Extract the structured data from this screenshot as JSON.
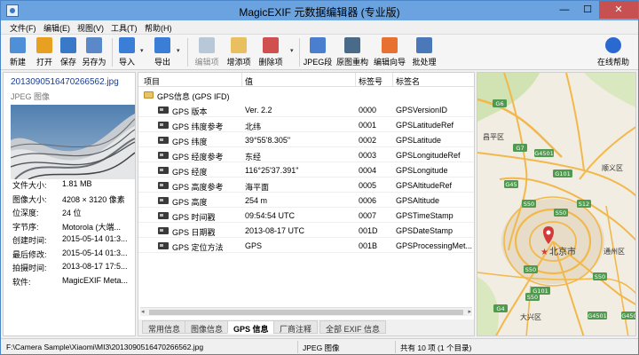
{
  "window": {
    "title": "MagicEXIF 元数据编辑器 (专业版)",
    "minimize": "—",
    "maximize": "☐",
    "close": "✕"
  },
  "menu": [
    {
      "label": "文件(F)"
    },
    {
      "label": "编辑(E)"
    },
    {
      "label": "视图(V)"
    },
    {
      "label": "工具(T)"
    },
    {
      "label": "帮助(H)"
    }
  ],
  "toolbar": {
    "new": "新建",
    "open": "打开",
    "save": "保存",
    "save_as": "另存为",
    "import": "导入",
    "export": "导出",
    "edit_item": "编辑项",
    "add_item": "增添项",
    "delete_item": "删除项",
    "jpeg_segment": "JPEG段",
    "rebuild": "原图重构",
    "wizard": "编辑向导",
    "batch": "批处理",
    "help": "在线帮助",
    "colors": {
      "new": "#4f8fd8",
      "open": "#e8a020",
      "save": "#3a78c8",
      "save_as": "#5a88c8",
      "import": "#3a7ed8",
      "export": "#3a7ed8",
      "edit_item": "#b8c8d8",
      "add_item": "#e8c060",
      "delete_item": "#d05050",
      "jpeg_segment": "#4a7fd0",
      "rebuild": "#4a6a8a",
      "wizard": "#e87030",
      "batch": "#4a78b8",
      "help": "#2a6ad0"
    }
  },
  "file": {
    "name": "20130905164702665​62.jpg",
    "type": "JPEG 图像",
    "properties": [
      {
        "label": "文件大小:",
        "value": "1.81 MB"
      },
      {
        "label": "图像大小:",
        "value": "4208 × 3120 像素"
      },
      {
        "label": "位深度:",
        "value": "24 位"
      },
      {
        "label": "字节序:",
        "value": "Motorola (大端..."
      },
      {
        "label": "创建时间:",
        "value": "2015-05-14 01:3..."
      },
      {
        "label": "最后修改:",
        "value": "2015-05-14 01:3..."
      },
      {
        "label": "拍摄时间:",
        "value": "2013-08-17 17:5..."
      },
      {
        "label": "软件:",
        "value": "MagicEXIF Meta..."
      }
    ]
  },
  "table": {
    "headers": {
      "item": "项目",
      "value": "值",
      "tag": "标签号",
      "tag_name": "标签名"
    },
    "group": "GPS信息 (GPS IFD)",
    "rows": [
      {
        "name": "GPS 版本",
        "value": "Ver. 2.2",
        "tag": "0000",
        "tag_name": "GPSVersionID"
      },
      {
        "name": "GPS 纬度参考",
        "value": "北纬",
        "tag": "0001",
        "tag_name": "GPSLatitudeRef"
      },
      {
        "name": "GPS 纬度",
        "value": "39°55'8.305\"",
        "tag": "0002",
        "tag_name": "GPSLatitude"
      },
      {
        "name": "GPS 经度参考",
        "value": "东经",
        "tag": "0003",
        "tag_name": "GPSLongitudeRef"
      },
      {
        "name": "GPS 经度",
        "value": "116°25'37.391\"",
        "tag": "0004",
        "tag_name": "GPSLongitude"
      },
      {
        "name": "GPS 高度参考",
        "value": "海平面",
        "tag": "0005",
        "tag_name": "GPSAltitudeRef"
      },
      {
        "name": "GPS 高度",
        "value": "254 m",
        "tag": "0006",
        "tag_name": "GPSAltitude"
      },
      {
        "name": "GPS 时间戳",
        "value": "09:54:54 UTC",
        "tag": "0007",
        "tag_name": "GPSTimeStamp"
      },
      {
        "name": "GPS 日期戳",
        "value": "2013-08-17 UTC",
        "tag": "001D",
        "tag_name": "GPSDateStamp"
      },
      {
        "name": "GPS 定位方法",
        "value": "GPS",
        "tag": "001B",
        "tag_name": "GPSProcessingMet..."
      }
    ],
    "tabs": [
      "常用信息",
      "图像信息",
      "GPS 信息",
      "厂商注释",
      "全部 EXIF 信息"
    ],
    "active_tab": "GPS 信息"
  },
  "map": {
    "labels": {
      "changping": "昌平区",
      "shunyi": "顺义区",
      "beijing": "北京市",
      "tongzhou": "通州区",
      "daxing": "大兴区"
    },
    "road_shields": [
      "G6",
      "G7",
      "G4501",
      "G101",
      "G45",
      "S50",
      "S12",
      "S50",
      "S50",
      "S50",
      "G101",
      "S50",
      "G4501",
      "G4501",
      "G4"
    ],
    "colors": {
      "background": "#f1ede2",
      "expressway": "#f2b84b",
      "urban_area": "#e6dcc7",
      "green": "#c9dfa8",
      "pin": "#d23a3a",
      "shield": "#4f9a4f"
    }
  },
  "status": {
    "path": "F:\\Camera Sample\\Xiaomi\\MI3\\20130905164702665​62.jpg",
    "type": "JPEG 图像",
    "count": "共有 10 项 (1 个目录)"
  }
}
